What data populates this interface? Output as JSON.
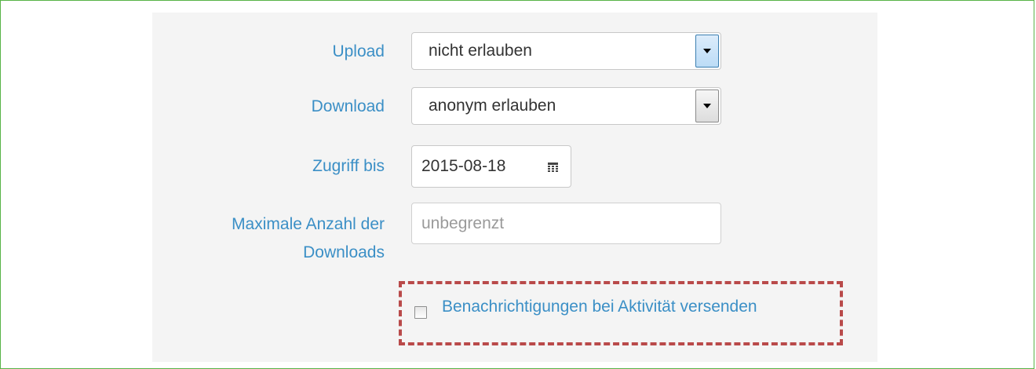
{
  "form": {
    "upload": {
      "label": "Upload",
      "value": "nicht erlauben"
    },
    "download": {
      "label": "Download",
      "value": "anonym erlauben"
    },
    "access_until": {
      "label": "Zugriff bis",
      "value": "2015-08-18",
      "icon": "calendar-icon"
    },
    "max_downloads": {
      "label_line1": "Maximale Anzahl der",
      "label_line2": "Downloads",
      "placeholder": "unbegrenzt",
      "value": ""
    },
    "notifications": {
      "label": "Benachrichtigungen bei Aktivität versenden",
      "checked": false
    }
  },
  "colors": {
    "label": "#3b8fc6",
    "frame_border": "#58b347",
    "highlight_border": "#b94a4a",
    "panel_background": "#f4f4f4"
  }
}
